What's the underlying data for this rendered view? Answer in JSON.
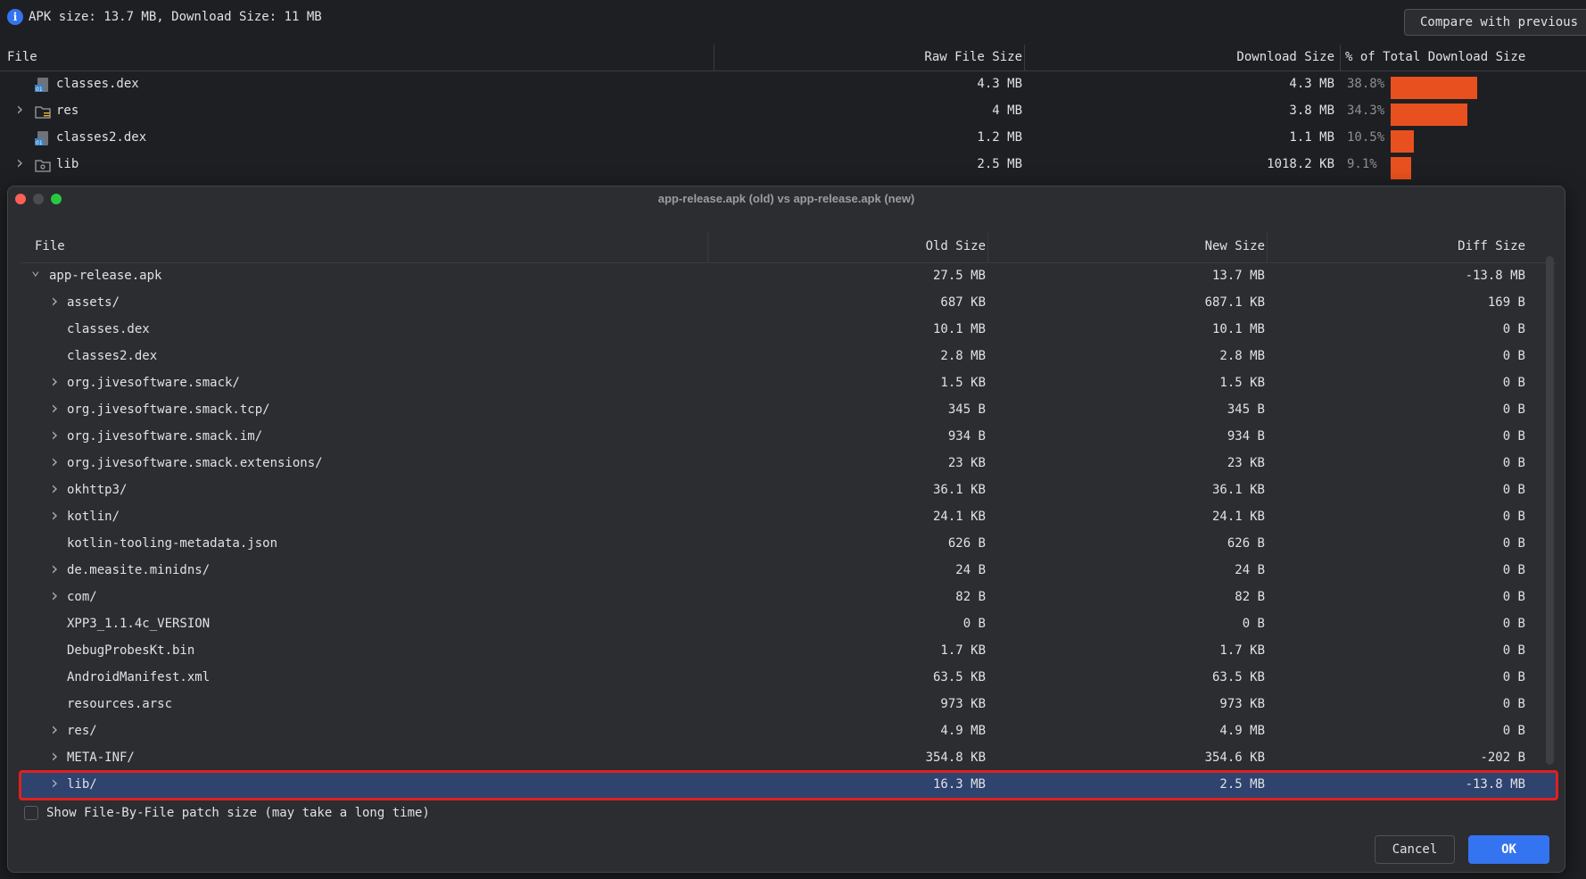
{
  "analyzer": {
    "summary": "APK size: 13.7 MB, Download Size: 11 MB",
    "compare_button": "Compare with previous",
    "columns": [
      "File",
      "Raw File Size",
      "Download Size",
      "% of Total Download Size"
    ],
    "rows": [
      {
        "name": "classes.dex",
        "raw": "4.3 MB",
        "download": "4.3 MB",
        "percent": "38.8%",
        "share": 38.8,
        "expandable": false,
        "icon": "dex-file-icon"
      },
      {
        "name": "res",
        "raw": "4 MB",
        "download": "3.8 MB",
        "percent": "34.3%",
        "share": 34.3,
        "expandable": true,
        "icon": "resource-folder-icon"
      },
      {
        "name": "classes2.dex",
        "raw": "1.2 MB",
        "download": "1.1 MB",
        "percent": "10.5%",
        "share": 10.5,
        "expandable": false,
        "icon": "dex-file-icon"
      },
      {
        "name": "lib",
        "raw": "2.5 MB",
        "download": "1018.2 KB",
        "percent": "9.1%",
        "share": 9.1,
        "expandable": true,
        "icon": "library-folder-icon"
      }
    ],
    "bar_color": "#e8511f"
  },
  "dialog": {
    "title": "app-release.apk (old) vs app-release.apk (new)",
    "columns": [
      "File",
      "Old Size",
      "New Size",
      "Diff Size"
    ],
    "rows": [
      {
        "name": "app-release.apk",
        "old": "27.5 MB",
        "new": "13.7 MB",
        "diff": "-13.8 MB",
        "level": 0,
        "chevron": "expanded"
      },
      {
        "name": "assets/",
        "old": "687 KB",
        "new": "687.1 KB",
        "diff": "169 B",
        "level": 1,
        "chevron": "collapsed"
      },
      {
        "name": "classes.dex",
        "old": "10.1 MB",
        "new": "10.1 MB",
        "diff": "0 B",
        "level": 1,
        "chevron": "none"
      },
      {
        "name": "classes2.dex",
        "old": "2.8 MB",
        "new": "2.8 MB",
        "diff": "0 B",
        "level": 1,
        "chevron": "none"
      },
      {
        "name": "org.jivesoftware.smack/",
        "old": "1.5 KB",
        "new": "1.5 KB",
        "diff": "0 B",
        "level": 1,
        "chevron": "collapsed"
      },
      {
        "name": "org.jivesoftware.smack.tcp/",
        "old": "345 B",
        "new": "345 B",
        "diff": "0 B",
        "level": 1,
        "chevron": "collapsed"
      },
      {
        "name": "org.jivesoftware.smack.im/",
        "old": "934 B",
        "new": "934 B",
        "diff": "0 B",
        "level": 1,
        "chevron": "collapsed"
      },
      {
        "name": "org.jivesoftware.smack.extensions/",
        "old": "23 KB",
        "new": "23 KB",
        "diff": "0 B",
        "level": 1,
        "chevron": "collapsed"
      },
      {
        "name": "okhttp3/",
        "old": "36.1 KB",
        "new": "36.1 KB",
        "diff": "0 B",
        "level": 1,
        "chevron": "collapsed"
      },
      {
        "name": "kotlin/",
        "old": "24.1 KB",
        "new": "24.1 KB",
        "diff": "0 B",
        "level": 1,
        "chevron": "collapsed"
      },
      {
        "name": "kotlin-tooling-metadata.json",
        "old": "626 B",
        "new": "626 B",
        "diff": "0 B",
        "level": 1,
        "chevron": "none"
      },
      {
        "name": "de.measite.minidns/",
        "old": "24 B",
        "new": "24 B",
        "diff": "0 B",
        "level": 1,
        "chevron": "collapsed"
      },
      {
        "name": "com/",
        "old": "82 B",
        "new": "82 B",
        "diff": "0 B",
        "level": 1,
        "chevron": "collapsed"
      },
      {
        "name": "XPP3_1.1.4c_VERSION",
        "old": "0 B",
        "new": "0 B",
        "diff": "0 B",
        "level": 1,
        "chevron": "none"
      },
      {
        "name": "DebugProbesKt.bin",
        "old": "1.7 KB",
        "new": "1.7 KB",
        "diff": "0 B",
        "level": 1,
        "chevron": "none"
      },
      {
        "name": "AndroidManifest.xml",
        "old": "63.5 KB",
        "new": "63.5 KB",
        "diff": "0 B",
        "level": 1,
        "chevron": "none"
      },
      {
        "name": "resources.arsc",
        "old": "973 KB",
        "new": "973 KB",
        "diff": "0 B",
        "level": 1,
        "chevron": "none"
      },
      {
        "name": "res/",
        "old": "4.9 MB",
        "new": "4.9 MB",
        "diff": "0 B",
        "level": 1,
        "chevron": "collapsed"
      },
      {
        "name": "META-INF/",
        "old": "354.8 KB",
        "new": "354.6 KB",
        "diff": "-202 B",
        "level": 1,
        "chevron": "collapsed"
      },
      {
        "name": "lib/",
        "old": "16.3 MB",
        "new": "2.5 MB",
        "diff": "-13.8 MB",
        "level": 1,
        "chevron": "collapsed",
        "selected": true
      }
    ],
    "patch_checkbox_label": "Show File-By-File patch size (may take a long time)",
    "patch_checkbox_checked": false,
    "cancel_label": "Cancel",
    "ok_label": "OK",
    "selection_color": "#2e436e",
    "highlight_color": "#e0201f",
    "accent_color": "#3574f0"
  }
}
